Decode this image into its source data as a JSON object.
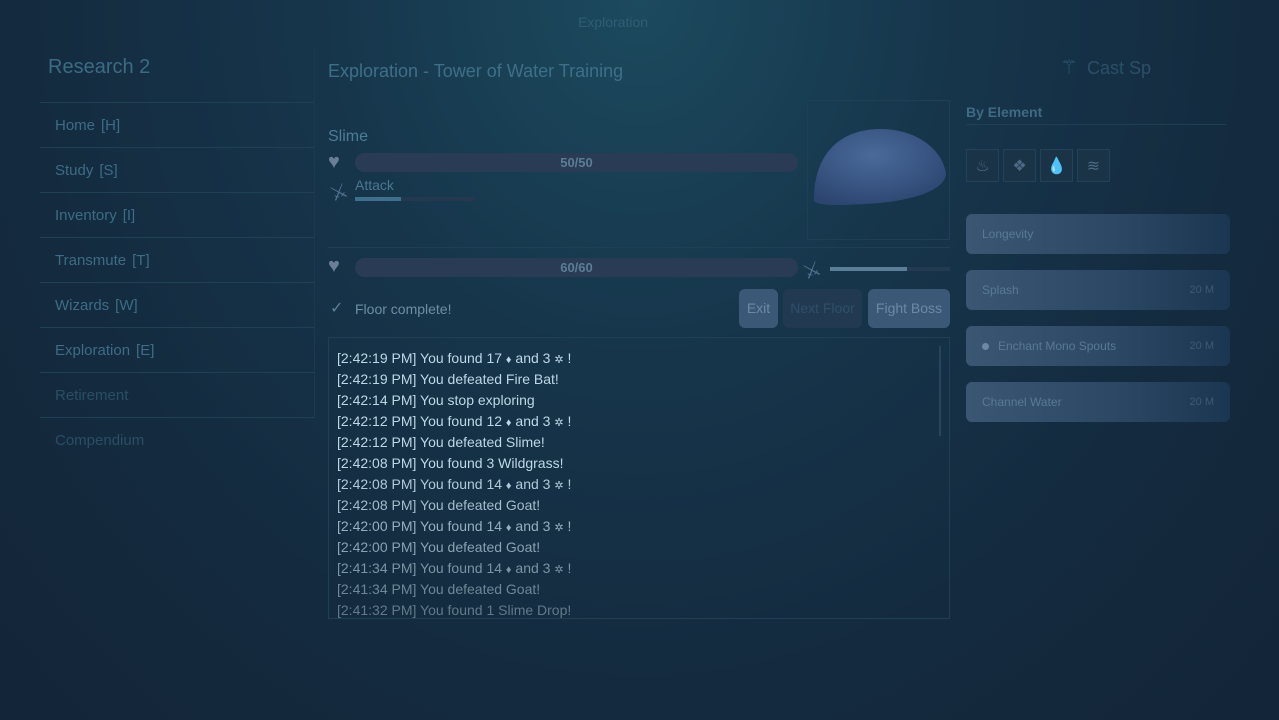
{
  "window_title": "Exploration",
  "app": {
    "title": "Research 2"
  },
  "sidebar": {
    "items": [
      {
        "label": "Home",
        "key": "[H]"
      },
      {
        "label": "Study",
        "key": "[S]"
      },
      {
        "label": "Inventory",
        "key": "[I]"
      },
      {
        "label": "Transmute",
        "key": "[T]"
      },
      {
        "label": "Wizards",
        "key": "[W]"
      },
      {
        "label": "Exploration",
        "key": "[E]"
      },
      {
        "label": "Retirement",
        "key": ""
      },
      {
        "label": "Compendium",
        "key": ""
      }
    ]
  },
  "main": {
    "title": "Exploration - Tower of Water Training",
    "monster": {
      "name": "Slime",
      "hp_text": "50/50",
      "hp_fraction": 1.0,
      "attack_label": "Attack",
      "attack_progress": 0.38
    },
    "player": {
      "hp_text": "60/60",
      "hp_fraction": 1.0,
      "attack_progress": 0.64
    },
    "floor_status": "Floor complete!",
    "buttons": {
      "exit": "Exit",
      "next_floor": "Next Floor",
      "fight_boss": "Fight Boss"
    },
    "log": [
      {
        "time": "[2:42:19 PM]",
        "text": "You found 17",
        "icon_a": "gem-icon",
        "mid": "and 3",
        "icon_b": "essence-icon",
        "end": "!"
      },
      {
        "time": "[2:42:19 PM]",
        "text": "You defeated Fire Bat!"
      },
      {
        "time": "[2:42:14 PM]",
        "text": "You stop exploring"
      },
      {
        "time": "[2:42:12 PM]",
        "text": "You found 12",
        "icon_a": "gem-icon",
        "mid": "and 3",
        "icon_b": "essence-icon",
        "end": "!"
      },
      {
        "time": "[2:42:12 PM]",
        "text": "You defeated Slime!"
      },
      {
        "time": "[2:42:08 PM]",
        "text": "You found 3 Wildgrass!"
      },
      {
        "time": "[2:42:08 PM]",
        "text": "You found 14",
        "icon_a": "gem-icon",
        "mid": "and 3",
        "icon_b": "essence-icon",
        "end": "!"
      },
      {
        "time": "[2:42:08 PM]",
        "text": "You defeated Goat!"
      },
      {
        "time": "[2:42:00 PM]",
        "text": "You found 14",
        "icon_a": "gem-icon",
        "mid": "and 3",
        "icon_b": "essence-icon",
        "end": "!"
      },
      {
        "time": "[2:42:00 PM]",
        "text": "You defeated Goat!"
      },
      {
        "time": "[2:41:34 PM]",
        "text": "You found 14",
        "icon_a": "gem-icon",
        "mid": "and 3",
        "icon_b": "essence-icon",
        "end": "!"
      },
      {
        "time": "[2:41:34 PM]",
        "text": "You defeated Goat!"
      },
      {
        "time": "[2:41:32 PM]",
        "text": "You found 1 Slime Drop!"
      }
    ]
  },
  "right": {
    "cast_title": "Cast Sp",
    "by_element": "By Element",
    "element_icons": [
      "fire-icon",
      "earth-icon",
      "water-icon",
      "air-icon"
    ],
    "spells": [
      {
        "label": "Longevity",
        "cost": "",
        "bullet": false
      },
      {
        "label": "Splash",
        "cost": "20 M",
        "bullet": false
      },
      {
        "label": "Enchant Mono Spouts",
        "cost": "20 M",
        "bullet": true
      },
      {
        "label": "Channel Water",
        "cost": "20 M",
        "bullet": false
      }
    ]
  },
  "colors": {
    "background": "#142a3e",
    "hp_bar": "#2a3c55",
    "button": "#3b5877",
    "button_disabled": "#223952"
  }
}
